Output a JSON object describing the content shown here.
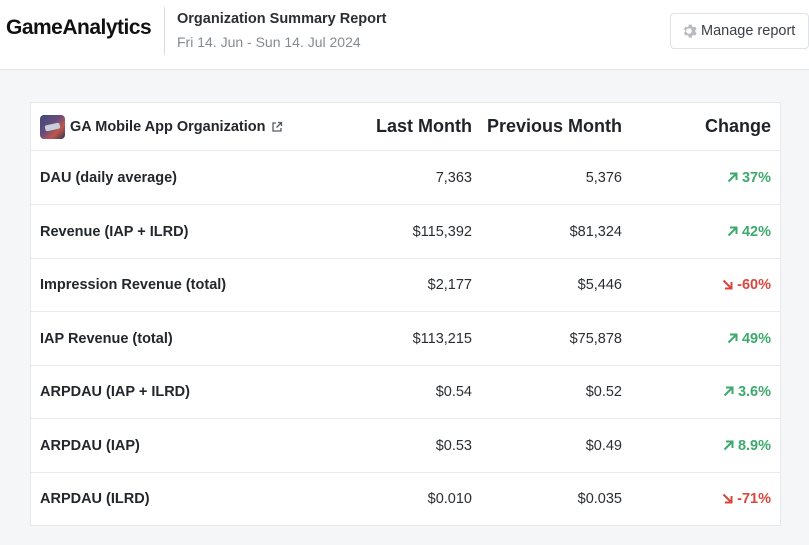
{
  "header": {
    "logo_text": "GameAnalytics",
    "report_title": "Organization Summary Report",
    "date_range": "Fri 14. Jun - Sun 14. Jul 2024",
    "manage_button_label": "Manage report",
    "manage_icon": "gear-icon"
  },
  "table": {
    "organization_name": "GA Mobile App Organization",
    "org_icon": "organization-avatar",
    "external_link_icon": "external-link-icon",
    "columns": [
      "Last Month",
      "Previous Month",
      "Change"
    ],
    "rows": [
      {
        "metric": "DAU (daily average)",
        "last": "7,363",
        "previous": "5,376",
        "change": "37%",
        "direction": "up"
      },
      {
        "metric": "Revenue (IAP + ILRD)",
        "last": "$115,392",
        "previous": "$81,324",
        "change": "42%",
        "direction": "up"
      },
      {
        "metric": "Impression Revenue (total)",
        "last": "$2,177",
        "previous": "$5,446",
        "change": "-60%",
        "direction": "down"
      },
      {
        "metric": "IAP Revenue (total)",
        "last": "$113,215",
        "previous": "$75,878",
        "change": "49%",
        "direction": "up"
      },
      {
        "metric": "ARPDAU (IAP + ILRD)",
        "last": "$0.54",
        "previous": "$0.52",
        "change": "3.6%",
        "direction": "up"
      },
      {
        "metric": "ARPDAU (IAP)",
        "last": "$0.53",
        "previous": "$0.49",
        "change": "8.9%",
        "direction": "up"
      },
      {
        "metric": "ARPDAU (ILRD)",
        "last": "$0.010",
        "previous": "$0.035",
        "change": "-71%",
        "direction": "down"
      }
    ]
  },
  "colors": {
    "positive": "#3daa6c",
    "negative": "#d9473c"
  }
}
